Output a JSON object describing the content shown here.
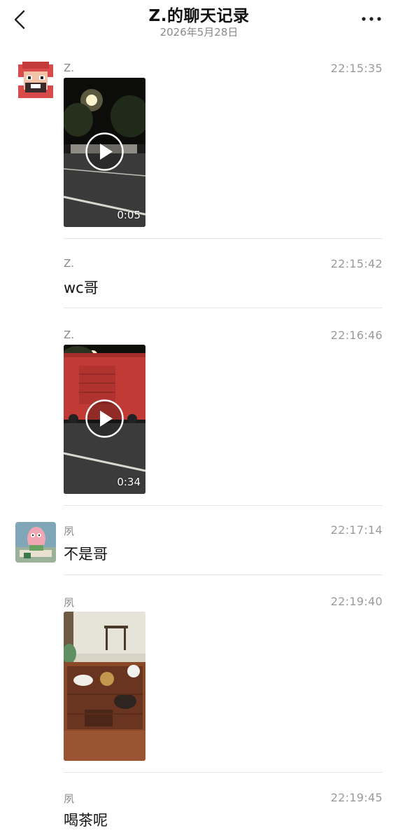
{
  "header": {
    "title": "Z.的聊天记录",
    "date": "2026年5月28日",
    "back_icon": "chevron-left-icon",
    "more_icon": "more-horizontal-icon"
  },
  "messages": [
    {
      "sender": "Z.",
      "time": "22:15:35",
      "type": "video",
      "duration": "0:05"
    },
    {
      "sender": "Z.",
      "time": "22:15:42",
      "type": "text",
      "text": "wc哥"
    },
    {
      "sender": "Z.",
      "time": "22:16:46",
      "type": "video",
      "duration": "0:34"
    },
    {
      "sender": "夙",
      "time": "22:17:14",
      "type": "text",
      "text": "不是哥"
    },
    {
      "sender": "夙",
      "time": "22:19:40",
      "type": "image"
    },
    {
      "sender": "夙",
      "time": "22:19:45",
      "type": "text",
      "text": "喝茶呢"
    }
  ]
}
